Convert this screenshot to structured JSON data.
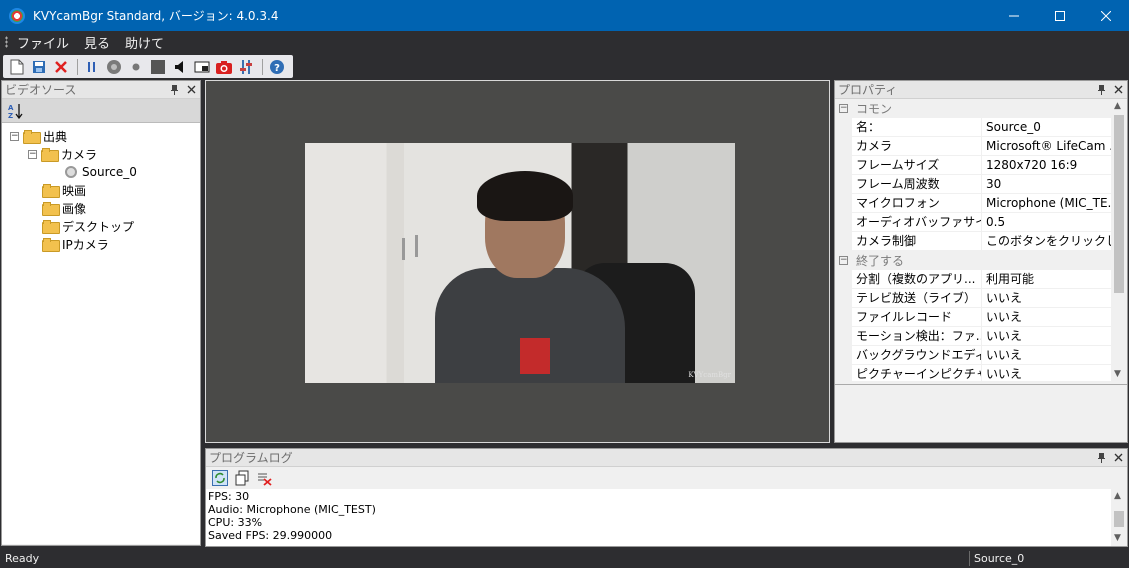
{
  "window": {
    "title": "KVYcamBgr Standard, バージョン: 4.0.3.4"
  },
  "menu": {
    "items": [
      "ファイル",
      "見る",
      "助けて"
    ]
  },
  "toolbar": {
    "icons": [
      "new-icon",
      "save-icon",
      "delete-icon",
      "pause-icon",
      "record-disc-icon",
      "dot-icon",
      "stop-icon",
      "speaker-icon",
      "window-icon",
      "camera-snapshot-icon",
      "settings-icon",
      "help-icon"
    ]
  },
  "video_source": {
    "title": "ビデオソース",
    "tree": {
      "root": "出典",
      "camera": "カメラ",
      "source": "Source_0",
      "movie": "映画",
      "image": "画像",
      "desktop": "デスクトップ",
      "ipcamera": "IPカメラ"
    }
  },
  "video": {
    "watermark": "KVYcamBgr"
  },
  "properties": {
    "title": "プロパティ",
    "categories": [
      {
        "name": "コモン",
        "rows": [
          {
            "name": "名：",
            "value": "Source_0"
          },
          {
            "name": "カメラ",
            "value": "Microsoft® LifeCam ..."
          },
          {
            "name": "フレームサイズ",
            "value": "1280x720 16:9"
          },
          {
            "name": "フレーム周波数",
            "value": "30"
          },
          {
            "name": "マイクロフォン",
            "value": "Microphone (MIC_TE..."
          },
          {
            "name": "オーディオバッファサイ...",
            "value": "0.5"
          },
          {
            "name": "カメラ制御",
            "value": "このボタンをクリックし..."
          }
        ]
      },
      {
        "name": "終了する",
        "rows": [
          {
            "name": "分割（複数のアプリ...",
            "value": "利用可能"
          },
          {
            "name": "テレビ放送（ライブ）",
            "value": "いいえ"
          },
          {
            "name": "ファイルレコード",
            "value": "いいえ"
          },
          {
            "name": "モーション検出：ファ...",
            "value": "いいえ"
          },
          {
            "name": "バックグラウンドエディ...",
            "value": "いいえ"
          },
          {
            "name": "ピクチャーインピクチャ...",
            "value": "いいえ"
          }
        ]
      }
    ]
  },
  "log": {
    "title": "プログラムログ",
    "lines": [
      "FPS: 30",
      "Audio: Microphone (MIC_TEST)",
      "CPU: 33%",
      "Saved FPS: 29.990000"
    ]
  },
  "status": {
    "left": "Ready",
    "right": "Source_0"
  },
  "colors": {
    "titlebar": "#0063b1",
    "dark_chrome": "#2d2d30",
    "video_bg": "#4a4a48"
  }
}
